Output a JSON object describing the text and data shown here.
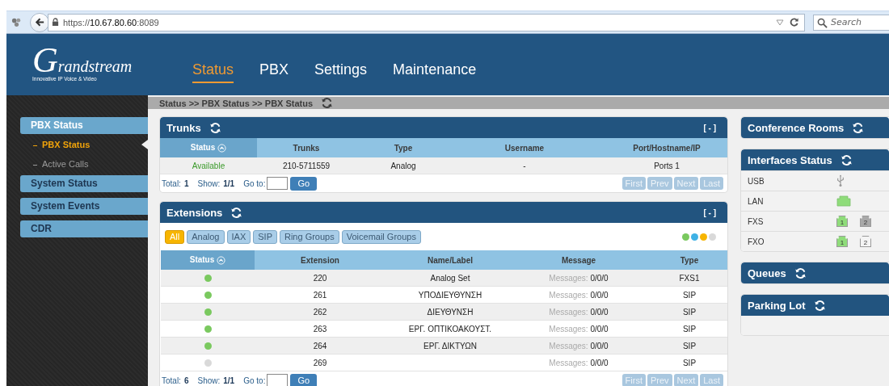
{
  "browser": {
    "url": "https://**10.67.80.60**:8089",
    "search": {
      "placeholder": "Search"
    }
  },
  "header": {
    "logo": {
      "name": "Grandstream",
      "tagline": "Innovative IP Voice & Video"
    },
    "nav": [
      {
        "label": "Status",
        "selected": true
      },
      {
        "label": "PBX",
        "selected": false
      },
      {
        "label": "Settings",
        "selected": false
      },
      {
        "label": "Maintenance",
        "selected": false
      }
    ]
  },
  "breadcrumb": "Status >> PBX Status >> PBX Status",
  "sidebar": {
    "items": [
      {
        "label": "PBX Status",
        "selected": true,
        "children": [
          {
            "label": "PBX Status",
            "selected": true
          },
          {
            "label": "Active Calls",
            "selected": false
          }
        ]
      },
      {
        "label": "System Status",
        "selected": false
      },
      {
        "label": "System Events",
        "selected": false
      },
      {
        "label": "CDR",
        "selected": false
      }
    ]
  },
  "trunks": {
    "title": "Trunks",
    "collapse": "[ - ]",
    "columns": [
      {
        "label": "Status",
        "sorted": true
      },
      {
        "label": "Trunks",
        "sorted": false
      },
      {
        "label": "Type",
        "sorted": false
      },
      {
        "label": "Username",
        "sorted": false
      },
      {
        "label": "Port/Hostname/IP",
        "sorted": false
      }
    ],
    "rows": [
      {
        "cells": [
          "Available",
          "210-5711559",
          "Analog",
          "-",
          "Ports 1"
        ]
      }
    ],
    "footer": {
      "total_label": "Total:",
      "total": "1",
      "show_label": "Show:",
      "show": "1/1",
      "goto_label": "Go to:",
      "go": "Go"
    },
    "pager": [
      {
        "label": "First",
        "disabled": true
      },
      {
        "label": "Prev",
        "disabled": true
      },
      {
        "label": "Next",
        "disabled": true
      },
      {
        "label": "Last",
        "disabled": true
      }
    ]
  },
  "extensions": {
    "title": "Extensions",
    "collapse": "[ - ]",
    "filters": [
      {
        "label": "All",
        "selected": true
      },
      {
        "label": "Analog",
        "selected": false
      },
      {
        "label": "IAX",
        "selected": false
      },
      {
        "label": "SIP",
        "selected": false
      },
      {
        "label": "Ring Groups",
        "selected": false
      },
      {
        "label": "Voicemail Groups",
        "selected": false
      }
    ],
    "legend": [
      {
        "color": "#7ac95f"
      },
      {
        "color": "#3fb1e5"
      },
      {
        "color": "#f7b500"
      },
      {
        "color": "#d9d9d9"
      }
    ],
    "columns": [
      {
        "label": "Status",
        "sorted": true
      },
      {
        "label": "Extension",
        "sorted": false
      },
      {
        "label": "Name/Label",
        "sorted": false
      },
      {
        "label": "Message",
        "sorted": false
      },
      {
        "label": "Type",
        "sorted": false
      }
    ],
    "rows": [
      {
        "color": "#7ac95f",
        "extension": "220",
        "name": "Analog Set",
        "message_label": "Messages:",
        "message": "0/0/0",
        "type": "FXS1"
      },
      {
        "color": "#7ac95f",
        "extension": "261",
        "name": "ΥΠΟΔΙΕΥΘΥΝΣΗ",
        "message_label": "Messages:",
        "message": "0/0/0",
        "type": "SIP"
      },
      {
        "color": "#7ac95f",
        "extension": "262",
        "name": "ΔΙΕΥΘΥΝΣΗ",
        "message_label": "Messages:",
        "message": "0/0/0",
        "type": "SIP"
      },
      {
        "color": "#7ac95f",
        "extension": "263",
        "name": "ΕΡΓ. ΟΠΤΙΚΟΑΚΟΥΣΤ.",
        "message_label": "Messages:",
        "message": "0/0/0",
        "type": "SIP"
      },
      {
        "color": "#7ac95f",
        "extension": "264",
        "name": "ΕΡΓ. ΔΙΚΤΥΩΝ",
        "message_label": "Messages:",
        "message": "0/0/0",
        "type": "SIP"
      },
      {
        "color": "#d9d9d9",
        "extension": "269",
        "message_label": "Messages:",
        "message": "0/0/0",
        "type": "SIP"
      }
    ],
    "footer": {
      "total_label": "Total:",
      "total": "6",
      "show_label": "Show:",
      "show": "1/1",
      "goto_label": "Go to:",
      "go": "Go"
    },
    "pager": [
      {
        "label": "First",
        "disabled": true
      },
      {
        "label": "Prev",
        "disabled": true
      },
      {
        "label": "Next",
        "disabled": true
      },
      {
        "label": "Last",
        "disabled": true
      }
    ]
  },
  "right_panels": [
    {
      "kind": "empty",
      "title": "Conference Rooms"
    },
    {
      "kind": "interfaces",
      "title": "Interfaces Status",
      "rows": [
        {
          "label": "USB",
          "ports": [
            {
              "kind": "usb"
            }
          ]
        },
        {
          "label": "LAN",
          "ports": [
            {
              "kind": "lan",
              "color": "#8fdc7a"
            }
          ]
        },
        {
          "label": "FXS",
          "ports": [
            {
              "kind": "jack",
              "label": "1",
              "color": "#8fdc7a"
            },
            {
              "kind": "jack",
              "label": "2",
              "color": "#a8a8a8"
            }
          ]
        },
        {
          "label": "FXO",
          "ports": [
            {
              "kind": "jack",
              "label": "1",
              "color": "#8fdc7a"
            },
            {
              "kind": "jack",
              "label": "2",
              "color": "#f4f4f4"
            }
          ]
        }
      ]
    },
    {
      "kind": "empty",
      "title": "Queues"
    },
    {
      "kind": "body",
      "title": "Parking Lot"
    }
  ]
}
